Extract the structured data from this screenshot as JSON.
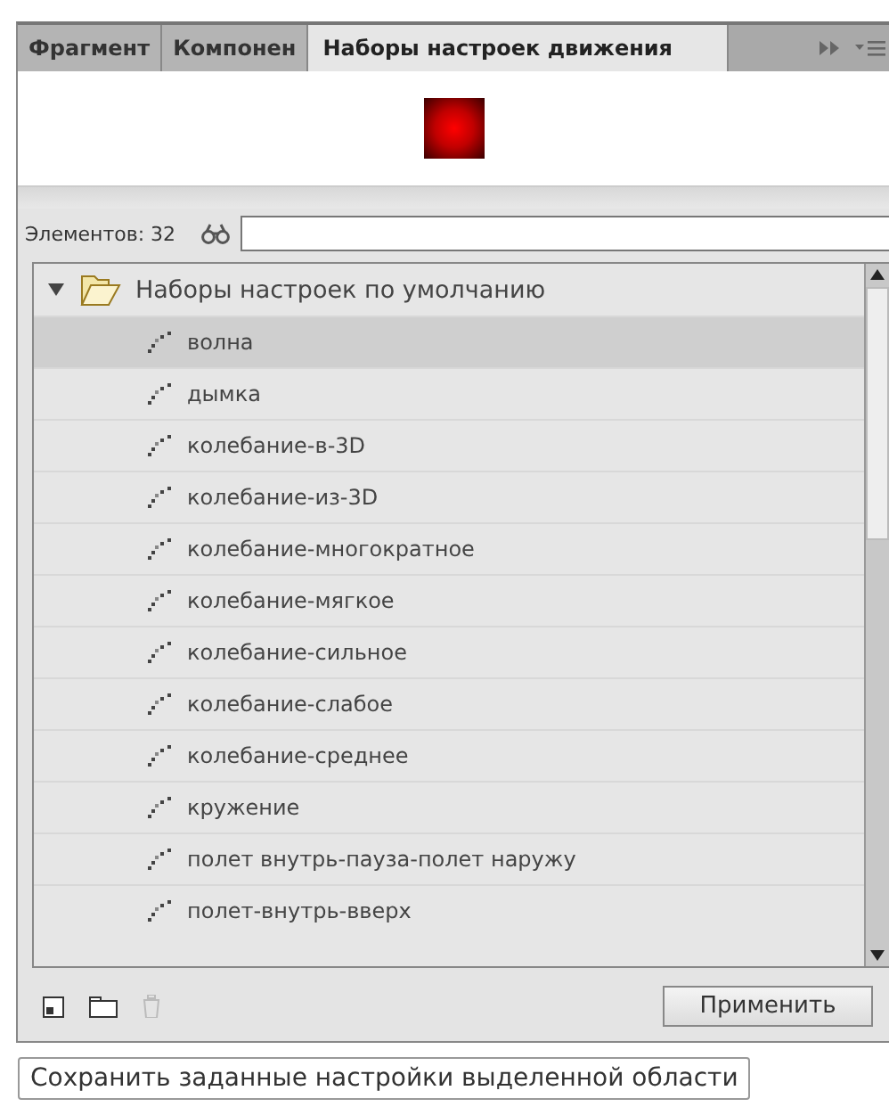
{
  "tabs": [
    {
      "label": "Фрагмент",
      "selected": false
    },
    {
      "label": "Компонен",
      "selected": false
    },
    {
      "label": "Наборы настроек движения",
      "selected": true
    }
  ],
  "count_label": "Элементов: 32",
  "tree": {
    "label": "Наборы настроек по умолчанию",
    "expanded": true,
    "children": [
      {
        "label": "волна",
        "selected": true
      },
      {
        "label": "дымка",
        "selected": false
      },
      {
        "label": "колебание-в-3D",
        "selected": false
      },
      {
        "label": "колебание-из-3D",
        "selected": false
      },
      {
        "label": "колебание-многократное",
        "selected": false
      },
      {
        "label": "колебание-мягкое",
        "selected": false
      },
      {
        "label": "колебание-сильное",
        "selected": false
      },
      {
        "label": "колебание-слабое",
        "selected": false
      },
      {
        "label": "колебание-среднее",
        "selected": false
      },
      {
        "label": "кружение",
        "selected": false
      },
      {
        "label": "полет внутрь-пауза-полет наружу",
        "selected": false
      },
      {
        "label": "полет-внутрь-вверх",
        "selected": false
      }
    ]
  },
  "apply_button": "Применить",
  "tooltip": "Сохранить заданные настройки выделенной области"
}
